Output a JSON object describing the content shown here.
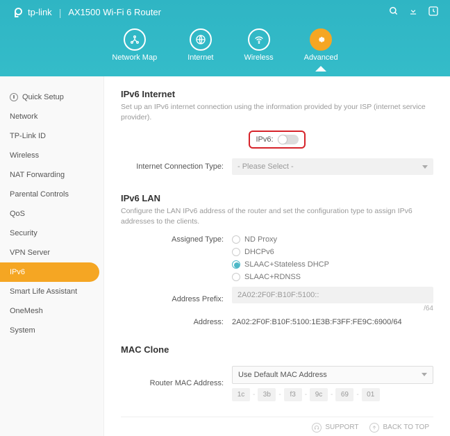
{
  "header": {
    "brand": "tp-link",
    "product": "AX1500 Wi-Fi 6 Router"
  },
  "tabs": {
    "network_map": "Network Map",
    "internet": "Internet",
    "wireless": "Wireless",
    "advanced": "Advanced"
  },
  "sidebar": {
    "quick_setup": "Quick Setup",
    "network": "Network",
    "tplink_id": "TP-Link ID",
    "wireless": "Wireless",
    "nat": "NAT Forwarding",
    "parental": "Parental Controls",
    "qos": "QoS",
    "security": "Security",
    "vpn": "VPN Server",
    "ipv6": "IPv6",
    "sla": "Smart Life Assistant",
    "onemesh": "OneMesh",
    "system": "System"
  },
  "ipv6_internet": {
    "title": "IPv6 Internet",
    "desc": "Set up an IPv6 internet connection using the information provided by your ISP (internet service provider).",
    "toggle_label": "IPv6:",
    "conn_type_label": "Internet Connection Type:",
    "conn_type_value": "- Please Select -"
  },
  "ipv6_lan": {
    "title": "IPv6 LAN",
    "desc": "Configure the LAN IPv6 address of the router and set the configuration type to assign IPv6 addresses to the clients.",
    "assigned_label": "Assigned Type:",
    "options": {
      "nd": "ND Proxy",
      "dhcp": "DHCPv6",
      "slaac_stateless": "SLAAC+Stateless DHCP",
      "slaac_rdnss": "SLAAC+RDNSS"
    },
    "prefix_label": "Address Prefix:",
    "prefix_value": "2A02:2F0F:B10F:5100::",
    "prefix_suffix": "/64",
    "address_label": "Address:",
    "address_value": "2A02:2F0F:B10F:5100:1E3B:F3FF:FE9C:6900/64"
  },
  "mac_clone": {
    "title": "MAC Clone",
    "label": "Router MAC Address:",
    "value": "Use Default MAC Address",
    "segments": [
      "1c",
      "3b",
      "f3",
      "9c",
      "69",
      "01"
    ]
  },
  "footer": {
    "support": "SUPPORT",
    "back": "BACK TO TOP"
  }
}
